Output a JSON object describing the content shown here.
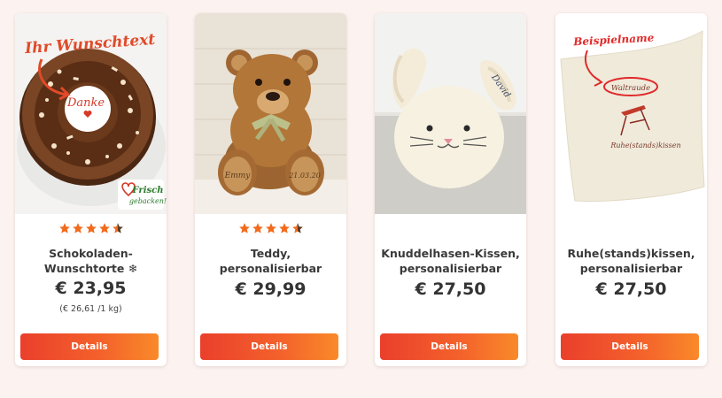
{
  "products": [
    {
      "name": "Schokoladen-Wunschtorte ❄",
      "price": "€ 23,95",
      "unit_price": "(€ 26,61 /1 kg)",
      "rating": 4.5,
      "button": "Details",
      "overlay_text": "Ihr Wunschtext",
      "cake_text": "Danke",
      "badge_line1": "Frisch",
      "badge_line2": "gebacken!"
    },
    {
      "name": "Teddy, personalisierbar",
      "price": "€ 29,99",
      "rating": 4.5,
      "button": "Details",
      "foot_left": "Emmy",
      "foot_right": "21.03.20"
    },
    {
      "name": "Knuddelhasen-Kissen, personalisierbar",
      "price": "€ 27,50",
      "button": "Details",
      "ear_text": "David"
    },
    {
      "name": "Ruhe(stands)kissen, personalisierbar",
      "price": "€ 27,50",
      "button": "Details",
      "overlay_text": "Beispielname",
      "pillow_name": "Waltraude",
      "pillow_text": "Ruhe(stands)kissen"
    }
  ],
  "colors": {
    "accent": "#f05a2a",
    "star": "#f26a1b",
    "background": "#fcf3f0"
  }
}
